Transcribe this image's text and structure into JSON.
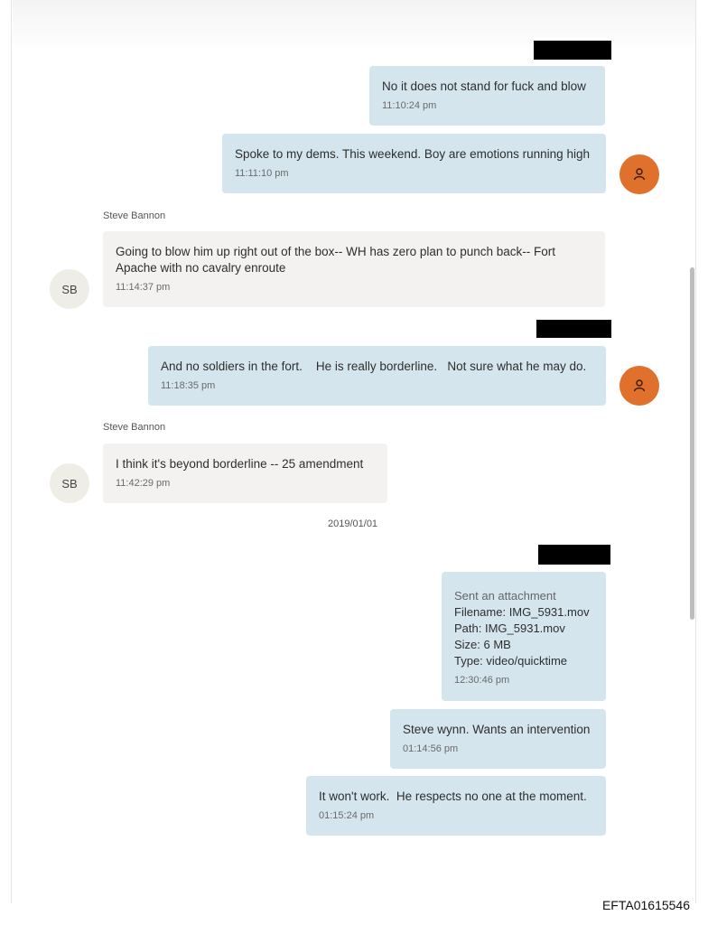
{
  "conversation": {
    "messages": [
      {
        "direction": "out",
        "text": "No it does not stand for fuck and blow",
        "time": "11:10:24 pm"
      },
      {
        "direction": "out",
        "text": "Spoke to my dems. This weekend. Boy are emotions running high",
        "time": "11:11:10 pm"
      },
      {
        "direction": "in",
        "sender": "Steve Bannon",
        "avatar": "SB",
        "text": "Going to blow him up right out of the box-- WH has zero plan to punch back-- Fort Apache with no cavalry enroute",
        "time": "11:14:37 pm"
      },
      {
        "direction": "out",
        "text": "And no soldiers in the fort.    He is really borderline.   Not sure what he may do.",
        "time": "11:18:35 pm"
      },
      {
        "direction": "in",
        "sender": "Steve Bannon",
        "avatar": "SB",
        "text": "I think it's beyond borderline -- 25 amendment",
        "time": "11:42:29 pm"
      },
      {
        "direction": "out",
        "time": "12:30:46 pm",
        "attachment": {
          "heading": "Sent an attachment",
          "filename": "Filename: IMG_5931.mov",
          "path": "Path: IMG_5931.mov",
          "size": "Size: 6 MB",
          "type": "Type: video/quicktime"
        }
      },
      {
        "direction": "out",
        "text": "Steve wynn. Wants an intervention",
        "time": "01:14:56 pm"
      },
      {
        "direction": "out",
        "text": "It won't work.  He respects no one at the moment.",
        "time": "01:15:24 pm"
      }
    ],
    "date_separator": "2019/01/01",
    "user_icon": "person-icon"
  },
  "footer": {
    "document_id": "EFTA01615546"
  },
  "colors": {
    "outgoing_bubble": "#d4e5ee",
    "incoming_bubble": "#f3f2f0",
    "user_avatar": "#e0712c",
    "redaction": "#000000"
  }
}
